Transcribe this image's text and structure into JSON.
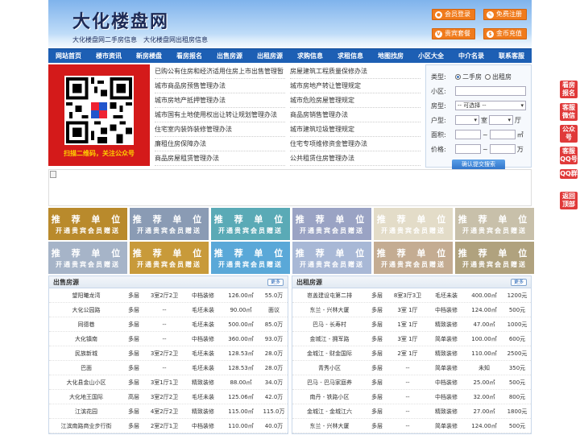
{
  "header": {
    "site_title": "大化楼盘网",
    "subtitle": "大化楼盘网二手房信息　大化楼盘网出租房信息",
    "buttons": [
      {
        "label": "会员登录",
        "icon": "user-icon"
      },
      {
        "label": "免费注册",
        "icon": "edit-icon"
      },
      {
        "label": "贵宾套餐",
        "icon": "vip-icon"
      },
      {
        "label": "金币充值",
        "icon": "coin-icon"
      }
    ]
  },
  "nav": [
    "网站首页",
    "楼市资讯",
    "新房楼盘",
    "看房报名",
    "出售房源",
    "出租房源",
    "求购信息",
    "求租信息",
    "地图找房",
    "小区大全",
    "中介名录",
    "联系客服"
  ],
  "qr": {
    "caption": "扫描二维码，关注公众号"
  },
  "links": [
    "已购公有住房和经济适用住房上市出售管理暂",
    "房屋建筑工程质量保修办法",
    "城市商品房预售管理办法",
    "城市房地产转让管理规定",
    "城市房地产抵押管理办法",
    "城市危险房屋管理规定",
    "城市国有土地使用权出让转让规划管理办法",
    "商品房销售管理办法",
    "住宅室内装饰装修管理办法",
    "城市建筑垃圾管理规定",
    "廉租住房保障办法",
    "住宅专项维修资金管理办法",
    "商品房屋租赁管理办法",
    "公共租赁住房管理办法"
  ],
  "search": {
    "type_label": "类型:",
    "option_sale": "二手房",
    "option_rent": "出租房",
    "community_label": "小区:",
    "housetype_label": "房型:",
    "housetype_value": "-- 可选择 --",
    "layout_label": "户型:",
    "room_unit": "室",
    "hall_unit": "厅",
    "area_label": "面积:",
    "area_sep": "~",
    "area_unit": "㎡",
    "price_label": "价格:",
    "price_sep": "~",
    "price_unit": "万",
    "submit_label": "确认提交搜索"
  },
  "ads": {
    "line1": "推 荐 单 位",
    "line2": "开通贵宾会员赠送",
    "colors": [
      "#b98a2c",
      "#8a9bb4",
      "#5aaab6",
      "#9aa3c4",
      "#e3dcc8",
      "#c8c0aa",
      "#a6b4c8",
      "#c89a3a",
      "#5aa8d8",
      "#a8b8d6",
      "#c4ac92",
      "#b0a27e"
    ]
  },
  "sale_table": {
    "title": "出售房源",
    "more": "更多",
    "rows": [
      [
        "望阳曦龙湾",
        "多层",
        "3室2厅2卫",
        "中档装修",
        "126.00㎡",
        "55.0万"
      ],
      [
        "大化公园路",
        "多层",
        "--",
        "毛坯未装",
        "90.00㎡",
        "面议"
      ],
      [
        "同德巷",
        "多层",
        "--",
        "毛坯未装",
        "500.00㎡",
        "85.0万"
      ],
      [
        "大化镇南",
        "多层",
        "--",
        "中档装修",
        "360.00㎡",
        "93.0万"
      ],
      [
        "民族新城",
        "多层",
        "3室2厅2卫",
        "毛坯未装",
        "128.53㎡",
        "28.0万"
      ],
      [
        "巴面",
        "多层",
        "--",
        "毛坯未装",
        "128.53㎡",
        "28.0万"
      ],
      [
        "大化县金山小区",
        "多层",
        "3室1厅1卫",
        "精致装修",
        "88.00㎡",
        "34.0万"
      ],
      [
        "大化地王国际",
        "高层",
        "3室2厅2卫",
        "毛坯未装",
        "125.06㎡",
        "42.0万"
      ],
      [
        "江滨花园",
        "多层",
        "4室2厅2卫",
        "精致装修",
        "115.00㎡",
        "115.0万"
      ],
      [
        "江滨南路商业步行街",
        "多层",
        "2室2厅1卫",
        "中档装修",
        "110.00㎡",
        "40.0万"
      ]
    ]
  },
  "rent_table": {
    "title": "出租房源",
    "more": "更多",
    "rows": [
      [
        "岜盖建设屯第二排",
        "多层",
        "8室3厅3卫",
        "毛坯未装",
        "400.00㎡",
        "1200元"
      ],
      [
        "东兰 - 兴林大厦",
        "多层",
        "3室 1厅",
        "中档装修",
        "124.00㎡",
        "500元"
      ],
      [
        "巴马 - 长寿村",
        "多层",
        "1室 1厅",
        "精致装修",
        "47.00㎡",
        "1000元"
      ],
      [
        "金城江 - 拥军路",
        "多层",
        "3室 1厅",
        "简单装修",
        "100.00㎡",
        "600元"
      ],
      [
        "金城江 - 财金国际",
        "多层",
        "2室 1厅",
        "精致装修",
        "110.00㎡",
        "2500元"
      ],
      [
        "青秀小区",
        "多层",
        "--",
        "简单装修",
        "未知",
        "350元"
      ],
      [
        "巴马 - 巴马家庭养",
        "多层",
        "--",
        "中档装修",
        "25.00㎡",
        "500元"
      ],
      [
        "南丹 - 铁路小区",
        "多层",
        "--",
        "中档装修",
        "32.00㎡",
        "800元"
      ],
      [
        "金城江 - 金城江六",
        "多层",
        "--",
        "精致装修",
        "27.00㎡",
        "1800元"
      ],
      [
        "东兰 - 兴林大厦",
        "多层",
        "--",
        "简单装修",
        "124.00㎡",
        "500元"
      ]
    ]
  },
  "floating": [
    "看房报名",
    "客服微信",
    "公众号",
    "客服QQ号",
    "QQ群",
    "返回顶部"
  ]
}
